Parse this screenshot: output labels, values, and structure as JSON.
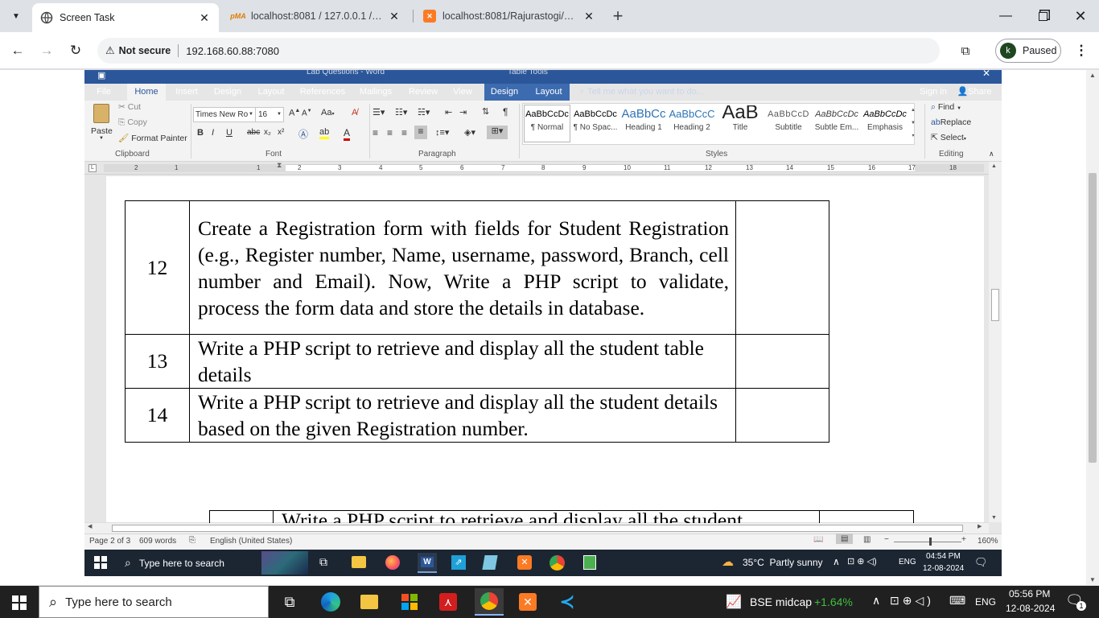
{
  "browser": {
    "tabs": [
      {
        "title": "Screen Task",
        "favicon": "screen-task-icon",
        "active": true
      },
      {
        "title": "localhost:8081 / 127.0.0.1 / stud",
        "favicon": "phpmyadmin-icon",
        "active": false
      },
      {
        "title": "localhost:8081/Rajurastogi/11d",
        "favicon": "xampp-icon",
        "active": false
      }
    ],
    "security_label": "Not secure",
    "url": "192.168.60.88:7080",
    "profile_initial": "k",
    "profile_status": "Paused"
  },
  "word": {
    "doc_title": "Lab Questions - Word",
    "context_tools": "Table Tools",
    "ribbon_tabs": [
      "File",
      "Home",
      "Insert",
      "Design",
      "Layout",
      "References",
      "Mailings",
      "Review",
      "View",
      "Design",
      "Layout"
    ],
    "tell_me": "Tell me what you want to do...",
    "sign_in": "Sign in",
    "share": "Share",
    "clipboard": {
      "paste": "Paste",
      "cut": "Cut",
      "copy": "Copy",
      "format_painter": "Format Painter",
      "label": "Clipboard"
    },
    "font": {
      "name": "Times New Ro",
      "size": "16",
      "label": "Font"
    },
    "paragraph_label": "Paragraph",
    "styles": [
      {
        "sample": "AaBbCcDc",
        "name": "¶ Normal"
      },
      {
        "sample": "AaBbCcDc",
        "name": "¶ No Spac..."
      },
      {
        "sample": "AaBbCc",
        "name": "Heading 1"
      },
      {
        "sample": "AaBbCcC",
        "name": "Heading 2"
      },
      {
        "sample": "AaB",
        "name": "Title"
      },
      {
        "sample": "AaBbCcD",
        "name": "Subtitle"
      },
      {
        "sample": "AaBbCcDc",
        "name": "Subtle Em..."
      },
      {
        "sample": "AaBbCcDc",
        "name": "Emphasis"
      }
    ],
    "styles_label": "Styles",
    "editing": {
      "find": "Find",
      "replace": "Replace",
      "select": "Select",
      "label": "Editing"
    },
    "ruler_numbers": [
      "2",
      "1",
      "1",
      "2",
      "3",
      "4",
      "5",
      "6",
      "7",
      "8",
      "9",
      "10",
      "11",
      "12",
      "13",
      "14",
      "15",
      "16",
      "17",
      "18"
    ],
    "table_rows": [
      {
        "num": "12",
        "text": "Create a Registration form with fields for Student Registration (e.g., Register number, Name, username, password, Branch, cell number and Email). Now, Write a PHP script to validate, process the form data and store the details in database."
      },
      {
        "num": "13",
        "text": "Write a PHP script to retrieve and display all the student table details"
      },
      {
        "num": "14",
        "text": "Write a PHP script to retrieve and display all the student details based on the given Registration number."
      },
      {
        "num": "",
        "text": "Write a PHP script to retrieve and display all the student"
      }
    ],
    "status": {
      "page": "Page 2 of 3",
      "words": "609 words",
      "language": "English (United States)",
      "zoom": "160%"
    }
  },
  "remote_taskbar": {
    "search": "Type here to search",
    "weather": "35°C  Partly sunny",
    "lang": "ENG",
    "time": "04:54 PM",
    "date": "12-08-2024"
  },
  "taskbar": {
    "search": "Type here to search",
    "stock_name": "BSE midcap",
    "stock_change": "+1.64%",
    "lang": "ENG",
    "time": "05:56 PM",
    "date": "12-08-2024",
    "notifications": "1"
  },
  "colors": {
    "word_blue": "#2b579a",
    "stock_green": "#3fbf3f",
    "taskbar": "#202020"
  }
}
